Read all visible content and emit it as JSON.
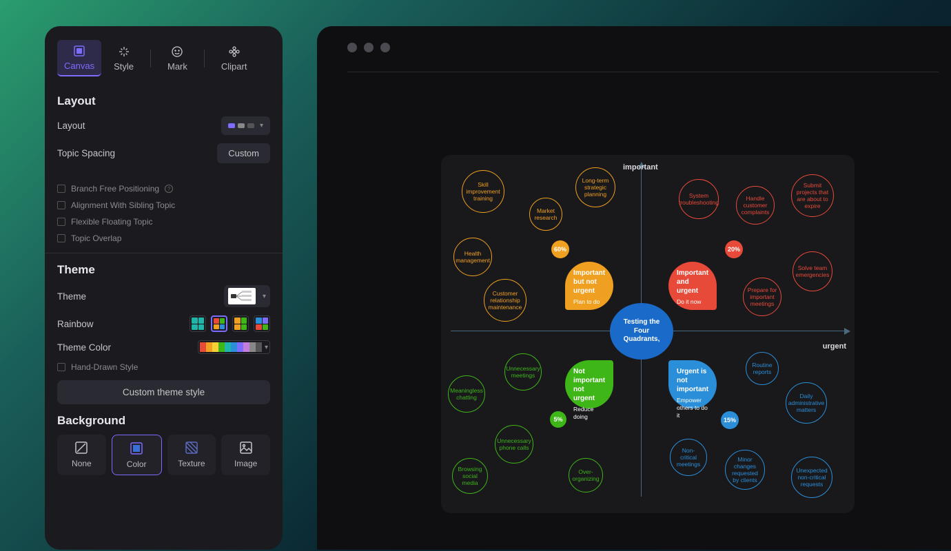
{
  "tabs": {
    "canvas": "Canvas",
    "style": "Style",
    "mark": "Mark",
    "clipart": "Clipart"
  },
  "layout": {
    "heading": "Layout",
    "layout_label": "Layout",
    "spacing_label": "Topic Spacing",
    "spacing_value": "Custom",
    "checks": {
      "branch_free": "Branch Free Positioning",
      "alignment": "Alignment With Sibling Topic",
      "flexible": "Flexible Floating Topic",
      "overlap": "Topic Overlap"
    }
  },
  "theme": {
    "heading": "Theme",
    "theme_label": "Theme",
    "rainbow_label": "Rainbow",
    "color_label": "Theme Color",
    "hand_drawn": "Hand-Drawn Style",
    "custom_btn": "Custom theme style",
    "palette": [
      "#e84a3a",
      "#f0a020",
      "#f7d038",
      "#3fb618",
      "#1fb5a8",
      "#2a8fd8",
      "#7c6cff",
      "#c47dd8",
      "#888",
      "#555"
    ]
  },
  "background": {
    "heading": "Background",
    "opts": {
      "none": "None",
      "color": "Color",
      "texture": "Texture",
      "image": "Image"
    }
  },
  "diagram": {
    "axis_top": "important",
    "axis_right": "urgent",
    "center": "Testing the Four Quadrants,",
    "q": {
      "tl": {
        "title": "Important but not urgent",
        "sub": "Plan to do",
        "pct": "60%"
      },
      "tr": {
        "title": "Important and urgent",
        "sub": "Do it now",
        "pct": "20%"
      },
      "bl": {
        "title": "Not important not urgent",
        "sub": "Reduce doing",
        "pct": "5%"
      },
      "br": {
        "title": "Urgent is not important",
        "sub": "Empower others to do it",
        "pct": "15%"
      }
    },
    "bubbles": {
      "tl": [
        "Skill improvement training",
        "Long-term strategic planning",
        "Market research",
        "Health management",
        "Customer relationship maintenance"
      ],
      "tr": [
        "System troubleshooting",
        "Handle customer complaints",
        "Submit projects that are about to expire",
        "Solve team emergencies",
        "Prepare for important meetings"
      ],
      "bl": [
        "Unnecessary meetings",
        "Meaningless chatting",
        "Unnecessary phone calls",
        "Browsing social media",
        "Over-organizing"
      ],
      "br": [
        "Routine reports",
        "Daily administrative matters",
        "Non-critical meetings",
        "Minor changes requested by clients",
        "Unexpected non-critical requests"
      ]
    }
  }
}
